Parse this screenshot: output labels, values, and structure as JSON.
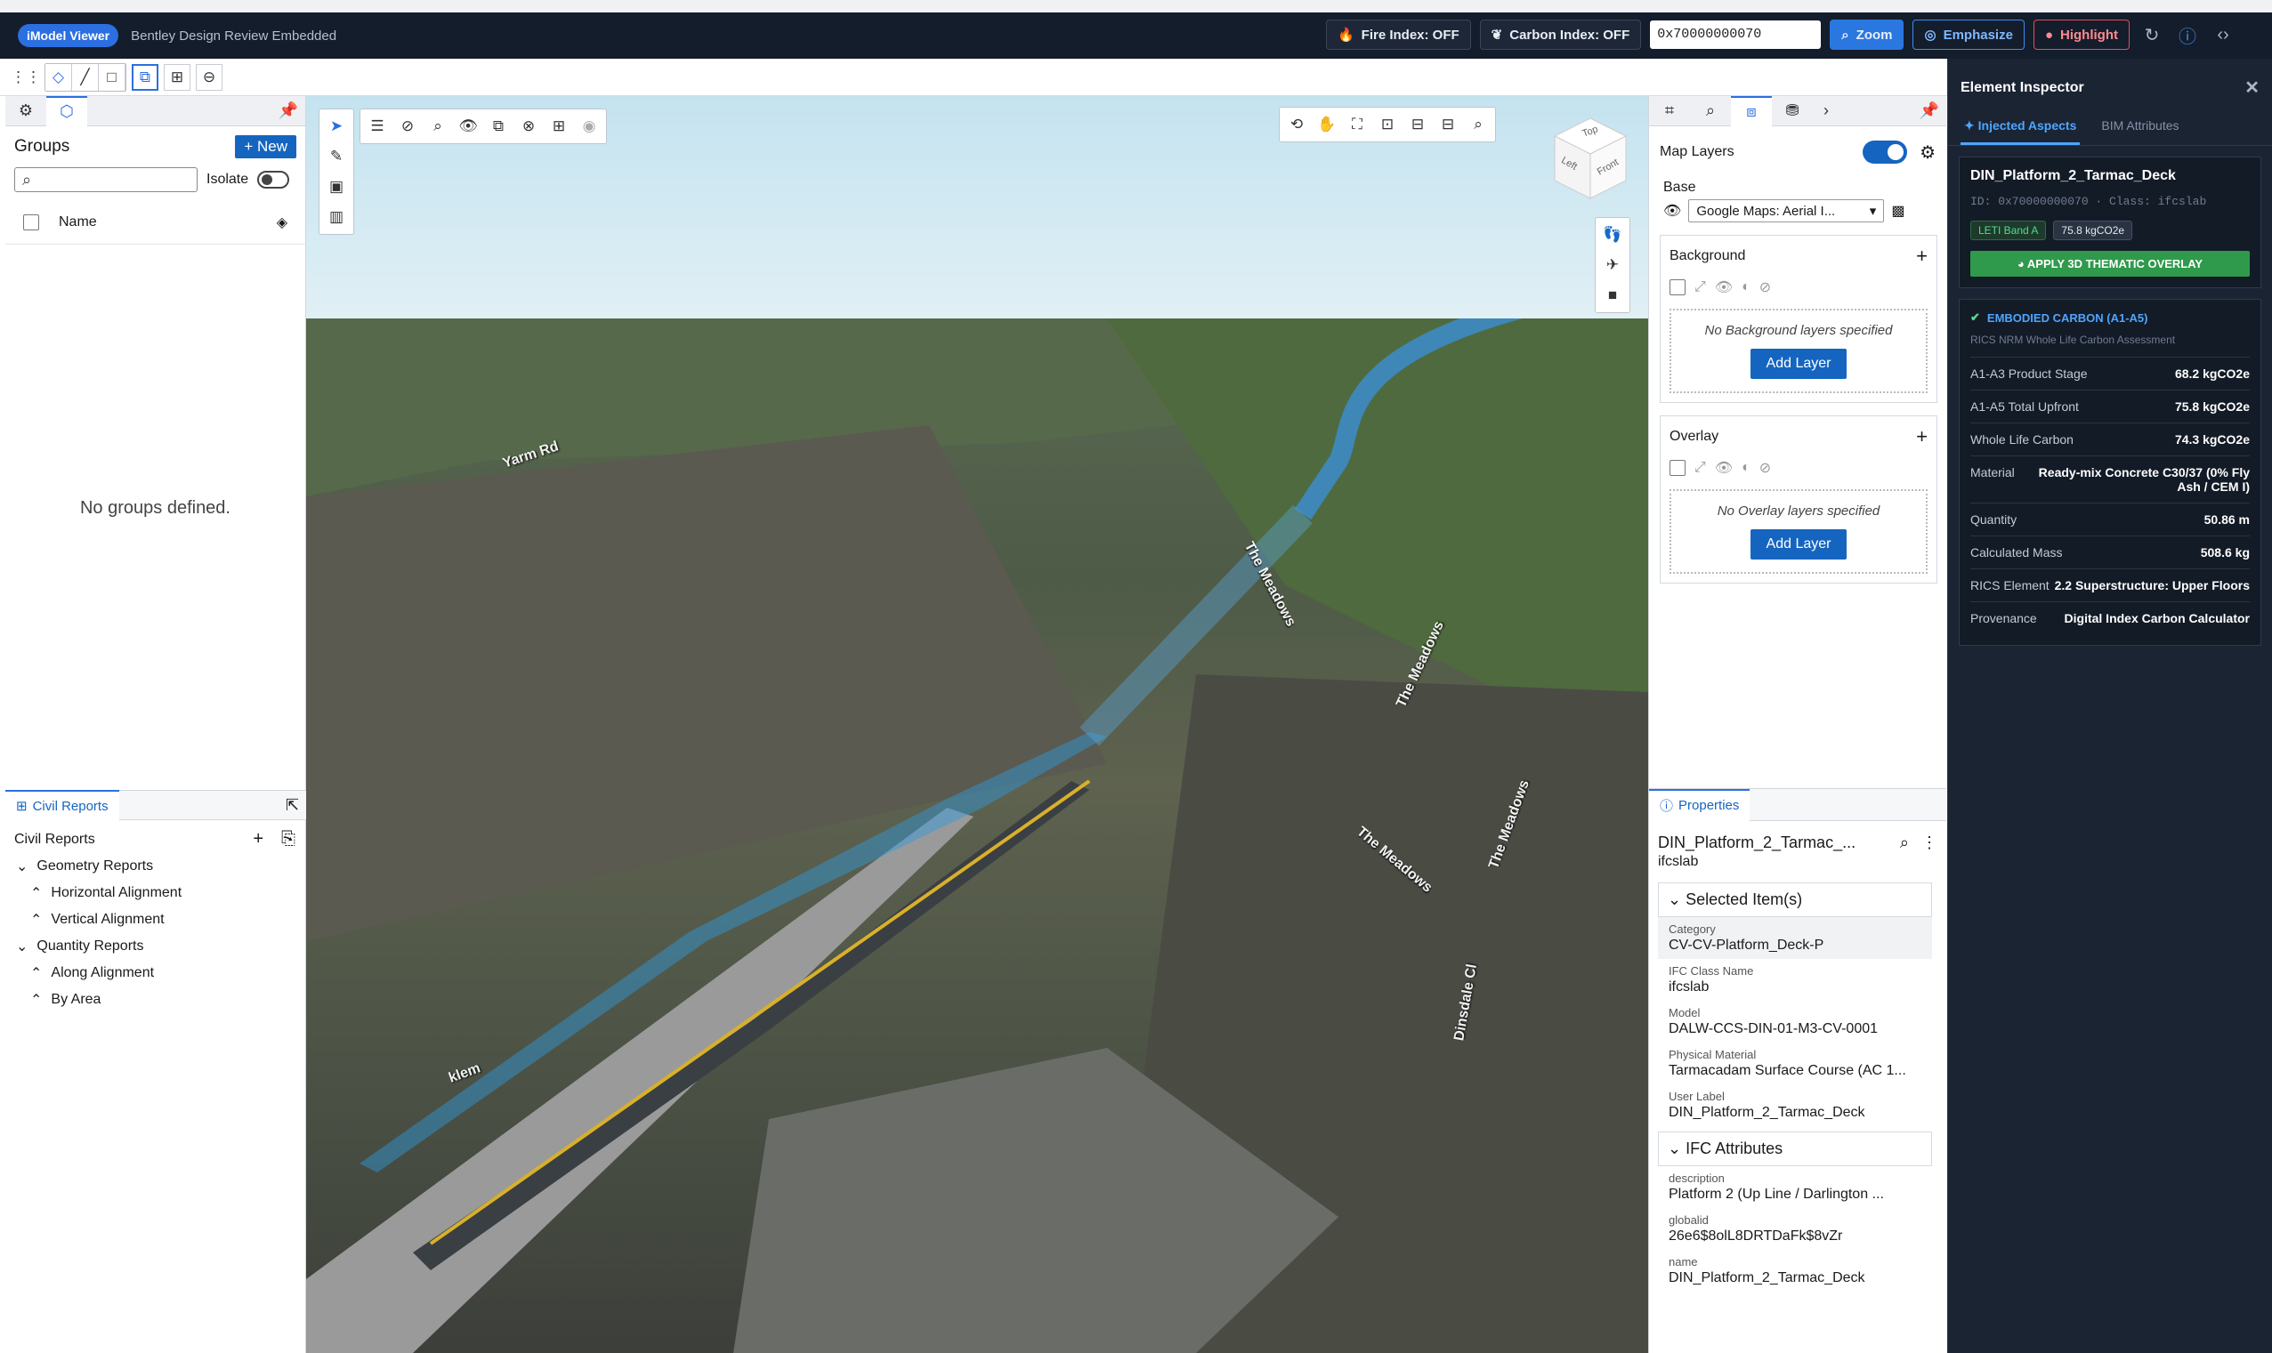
{
  "topbar": {
    "brand": "iModel Viewer",
    "subtitle": "Bentley Design Review Embedded",
    "fire_index": "Fire Index: OFF",
    "carbon_index": "Carbon Index: OFF",
    "element_id_value": "0x70000000070",
    "zoom": "Zoom",
    "emphasize": "Emphasize",
    "highlight": "Highlight"
  },
  "left": {
    "groups_title": "Groups",
    "new_label": "New",
    "isolate_label": "Isolate",
    "name_header": "Name",
    "empty_text": "No groups defined.",
    "civil_tab": "Civil Reports",
    "civil_title": "Civil Reports",
    "tree": [
      {
        "label": "Geometry Reports",
        "level": 0,
        "icon": "chevron-down"
      },
      {
        "label": "Horizontal Alignment",
        "level": 1,
        "icon": "chevron-up"
      },
      {
        "label": "Vertical Alignment",
        "level": 1,
        "icon": "chevron-up"
      },
      {
        "label": "Quantity Reports",
        "level": 0,
        "icon": "chevron-down"
      },
      {
        "label": "Along Alignment",
        "level": 1,
        "icon": "chevron-up"
      },
      {
        "label": "By Area",
        "level": 1,
        "icon": "chevron-up"
      }
    ]
  },
  "viewport": {
    "cube_top": "Top",
    "cube_left": "Left",
    "cube_front": "Front",
    "road_labels": [
      "Yarm Rd",
      "The Meadows",
      "The Meadows",
      "The Meadows",
      "Dinsdale Cl",
      "klem",
      "The Meadows"
    ]
  },
  "maplayers": {
    "title": "Map Layers",
    "base_label": "Base",
    "base_value": "Google Maps: Aerial I...",
    "background_label": "Background",
    "no_background": "No Background layers specified",
    "overlay_label": "Overlay",
    "no_overlay": "No Overlay layers specified",
    "add_layer": "Add Layer"
  },
  "properties": {
    "tab_label": "Properties",
    "title": "DIN_Platform_2_Tarmac_...",
    "subtitle": "ifcslab",
    "selected_section": "Selected Item(s)",
    "items": [
      {
        "label": "Category",
        "value": "CV-CV-Platform_Deck-P"
      },
      {
        "label": "IFC Class Name",
        "value": "ifcslab"
      },
      {
        "label": "Model",
        "value": "DALW-CCS-DIN-01-M3-CV-0001"
      },
      {
        "label": "Physical Material",
        "value": "Tarmacadam Surface Course (AC 1..."
      },
      {
        "label": "User Label",
        "value": "DIN_Platform_2_Tarmac_Deck"
      }
    ],
    "ifc_section": "IFC Attributes",
    "ifc_items": [
      {
        "label": "description",
        "value": "Platform 2 (Up Line / Darlington ..."
      },
      {
        "label": "globalid",
        "value": "26e6$8olL8DRTDaFk$8vZr"
      },
      {
        "label": "name",
        "value": "DIN_Platform_2_Tarmac_Deck"
      }
    ]
  },
  "inspector": {
    "title": "Element Inspector",
    "tab_injected": "Injected Aspects",
    "tab_bim": "BIM Attributes",
    "element_name": "DIN_Platform_2_Tarmac_Deck",
    "element_id": "ID: 0x70000000070 · Class: ifcslab",
    "chip_band": "LETI Band A",
    "chip_carbon": "75.8 kgCO2e",
    "apply_button": "APPLY 3D THEMATIC OVERLAY",
    "carbon_title": "EMBODIED CARBON (A1-A5)",
    "carbon_sub": "RICS NRM Whole Life Carbon Assessment",
    "rows": [
      {
        "k": "A1-A3 Product Stage",
        "v": "68.2 kgCO2e"
      },
      {
        "k": "A1-A5 Total Upfront",
        "v": "75.8 kgCO2e"
      },
      {
        "k": "Whole Life Carbon",
        "v": "74.3 kgCO2e"
      },
      {
        "k": "Material",
        "v": "Ready-mix Concrete C30/37 (0% Fly Ash / CEM I)"
      },
      {
        "k": "Quantity",
        "v": "50.86 m"
      },
      {
        "k": "Calculated Mass",
        "v": "508.6 kg"
      },
      {
        "k": "RICS Element",
        "v": "2.2 Superstructure: Upper Floors"
      },
      {
        "k": "Provenance",
        "v": "Digital Index Carbon Calculator"
      }
    ]
  },
  "colors": {
    "topbar_bg": "#141d2b",
    "accent": "#1565c0",
    "inspector_bg": "#1b2433",
    "apply_green": "#2f9a4c"
  }
}
